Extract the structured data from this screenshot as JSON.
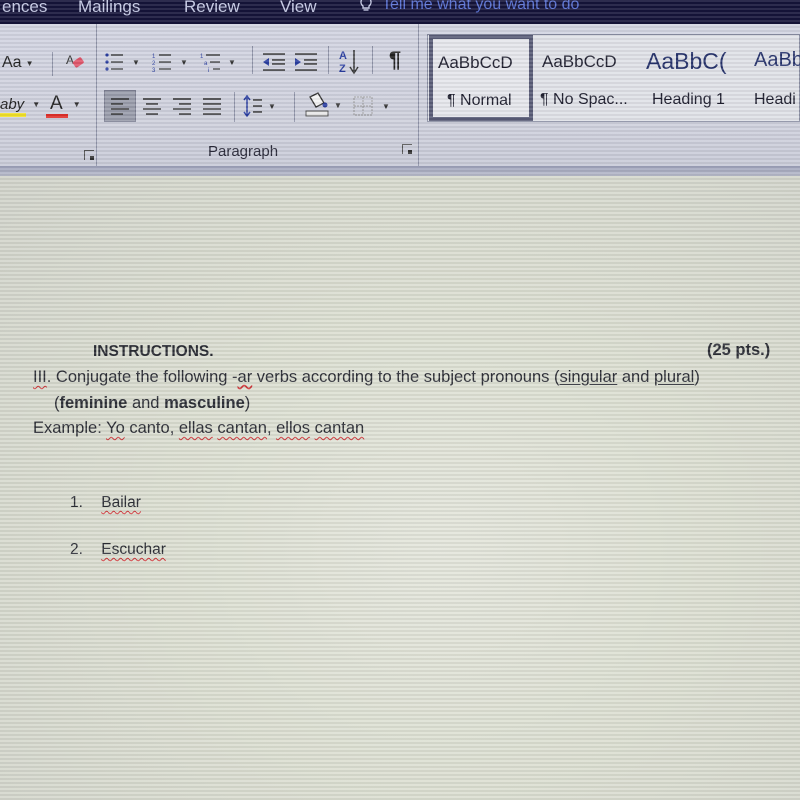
{
  "tabs": [
    "ences",
    "Mailings",
    "Review",
    "View"
  ],
  "tell_me": {
    "placeholder": "Tell me what you want to do"
  },
  "ribbon": {
    "font_group": {
      "change_case_label": "Aa",
      "clear_formatting_icon": "eraser-icon",
      "highlight_label": "aby",
      "font_color_label": "A",
      "highlight_color": "#f2e22a",
      "font_color_bar": "#e0302a"
    },
    "paragraph_group": {
      "label": "Paragraph",
      "buttons": [
        "bullets",
        "numbering",
        "multilevel-list",
        "decrease-indent",
        "increase-indent",
        "sort",
        "show-hide",
        "align-left",
        "center",
        "align-right",
        "justify",
        "line-spacing",
        "shading",
        "borders"
      ],
      "sort_label": "A Z",
      "pilcrow": "¶"
    },
    "styles": [
      {
        "preview": "AaBbCcD",
        "name": "¶ Normal",
        "selected": true
      },
      {
        "preview": "AaBbCcD",
        "name": "¶ No Spac...",
        "selected": false
      },
      {
        "preview": "AaBbC(",
        "name": "Heading 1",
        "selected": false
      },
      {
        "preview": "AaBb",
        "name": "Headi",
        "selected": false
      }
    ]
  },
  "document": {
    "heading": "INSTRUCTIONS.",
    "points": "(25 pts.)",
    "line1": {
      "roman": "III",
      "text_a": ". Conjugate the following -",
      "ar": "ar",
      "text_b": " verbs according to the subject pronouns (",
      "singular": "singular",
      "and": " and ",
      "plural": "plural",
      "close": ")"
    },
    "line2": {
      "open": "(",
      "feminine": "feminine",
      "and": " and ",
      "masculine": "masculine",
      "close": ")"
    },
    "example": {
      "label": "Example: ",
      "yo": "Yo",
      "canto": " canto, ",
      "ellas": "ellas",
      "cantan1": "cantan",
      "comma": ", ",
      "ellos": "ellos",
      "space": " ",
      "cantan2": "cantan"
    },
    "list": [
      {
        "number": "1.",
        "verb": "Bailar"
      },
      {
        "number": "2.",
        "verb": "Escuchar"
      }
    ]
  }
}
